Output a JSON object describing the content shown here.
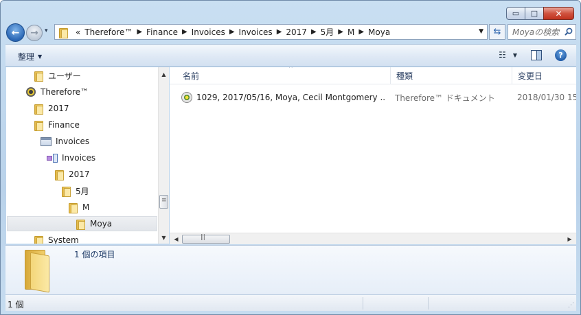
{
  "window": {
    "minimize_glyph": "▭",
    "maximize_glyph": "□",
    "close_glyph": "✕"
  },
  "nav": {
    "back_glyph": "←",
    "forward_glyph": "→",
    "recent_glyph": "▾",
    "overflow": "«",
    "sep_glyph": "▶",
    "breadcrumbs": [
      "Therefore™",
      "Finance",
      "Invoices",
      "Invoices",
      "2017",
      "5月",
      "M",
      "Moya"
    ],
    "dropdown_glyph": "▼",
    "refresh_glyph": "⇆"
  },
  "search": {
    "placeholder": "Moyaの検索"
  },
  "toolbar": {
    "organize_label": "整理",
    "organize_arrow": "▼",
    "view_glyph": "☷",
    "view_arrow": "▼",
    "help_glyph": "?"
  },
  "tree": {
    "items": [
      {
        "label": "ユーザー",
        "icon": "folder-icon"
      },
      {
        "label": "Therefore™",
        "icon": "therefore-server-icon"
      },
      {
        "label": "2017",
        "icon": "folder-icon"
      },
      {
        "label": "Finance",
        "icon": "folder-icon"
      },
      {
        "label": "Invoices",
        "icon": "cabinet-icon"
      },
      {
        "label": "Invoices",
        "icon": "workflow-category-icon"
      },
      {
        "label": "2017",
        "icon": "folder-icon"
      },
      {
        "label": "5月",
        "icon": "folder-icon"
      },
      {
        "label": "M",
        "icon": "folder-icon"
      },
      {
        "label": "Moya",
        "icon": "folder-icon",
        "selected": true
      },
      {
        "label": "System",
        "icon": "folder-icon"
      }
    ],
    "scroll_up": "▲",
    "scroll_down": "▼",
    "scroll_grip": "≡"
  },
  "list": {
    "columns": [
      "名前",
      "種類",
      "変更日"
    ],
    "sort_caret": "^",
    "rows": [
      {
        "name": "1029, 2017/05/16, Moya, Cecil Montgomery ...",
        "type": "Therefore™ ドキュメント",
        "date": "2018/01/30 15"
      }
    ],
    "hscroll_left": "◀",
    "hscroll_right": "▶",
    "hscroll_grip": "|||"
  },
  "details": {
    "count_text": "1 個の項目"
  },
  "status": {
    "text": "1 個",
    "grip": "⋰"
  },
  "colors": {
    "accent": "#2a67b5",
    "selection": "#e2e5ea"
  }
}
